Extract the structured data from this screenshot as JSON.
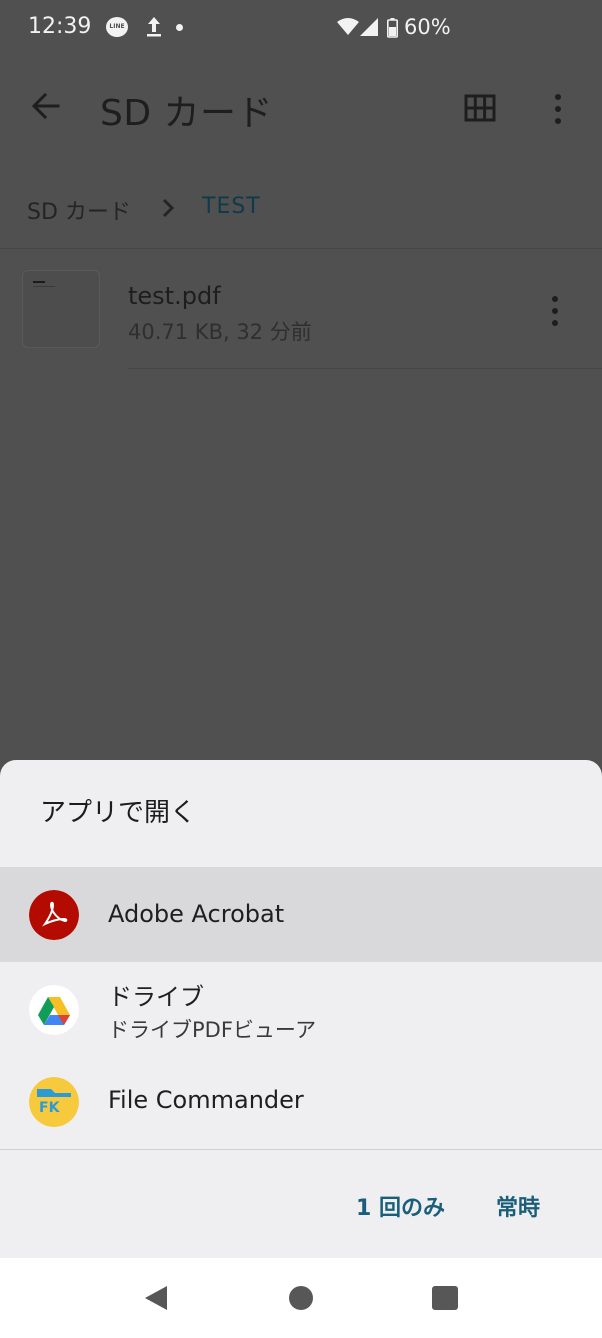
{
  "status_bar": {
    "time": "12:39",
    "notification_icons": [
      "line-app-icon",
      "upload-icon",
      "dot-icon"
    ],
    "line_label": "LINE",
    "battery_percent": "60%",
    "system_icons": [
      "wifi-icon",
      "signal-icon",
      "battery-icon"
    ]
  },
  "app_bar": {
    "title": "SD カード",
    "back_icon": "arrow-left-icon",
    "grid_icon": "grid-view-icon",
    "menu_icon": "more-vert-icon"
  },
  "breadcrumb": {
    "root": "SD カード",
    "current": "TEST"
  },
  "files": [
    {
      "name": "test.pdf",
      "meta": "40.71 KB, 32 分前"
    }
  ],
  "sheet": {
    "title": "アプリで開く",
    "apps": [
      {
        "name": "Adobe Acrobat",
        "subtitle": "",
        "icon": "adobe-acrobat-icon",
        "selected": true
      },
      {
        "name": "ドライブ",
        "subtitle": "ドライブPDFビューア",
        "icon": "google-drive-icon",
        "selected": false
      },
      {
        "name": "File Commander",
        "subtitle": "",
        "icon": "file-commander-icon",
        "selected": false
      }
    ],
    "once_label": "1 回のみ",
    "always_label": "常時"
  },
  "nav_bar": {
    "back_icon": "nav-back-icon",
    "home_icon": "nav-home-icon",
    "recents_icon": "nav-recents-icon"
  },
  "colors": {
    "scrim_background": "#505050",
    "sheet_background": "#efeff1",
    "selected_row": "#d9d9db",
    "accent_button": "#1a5e7a",
    "acrobat_red": "#b30b00"
  }
}
